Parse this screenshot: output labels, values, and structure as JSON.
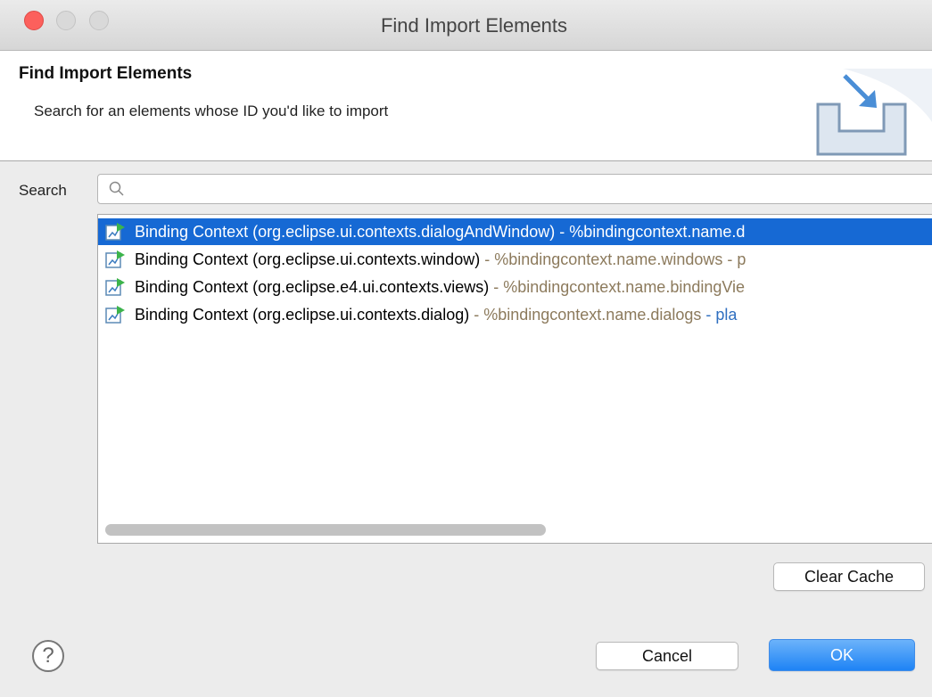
{
  "window": {
    "title": "Find Import Elements"
  },
  "header": {
    "title": "Find Import Elements",
    "description": "Search for an elements whose ID you'd like to import"
  },
  "search": {
    "label": "Search",
    "value": "",
    "placeholder": ""
  },
  "results": [
    {
      "main": "Binding Context (org.eclipse.ui.contexts.dialogAndWindow)",
      "sep": " - ",
      "name": "%bindingcontext.name.d",
      "extra": "",
      "selected": true
    },
    {
      "main": "Binding Context (org.eclipse.ui.contexts.window)",
      "sep": " - ",
      "name": "%bindingcontext.name.windows",
      "extra": " - p",
      "selected": false
    },
    {
      "main": "Binding Context (org.eclipse.e4.ui.contexts.views)",
      "sep": " - ",
      "name": "%bindingcontext.name.bindingVie",
      "extra": "",
      "selected": false
    },
    {
      "main": "Binding Context (org.eclipse.ui.contexts.dialog)",
      "sep": " - ",
      "name": "%bindingcontext.name.dialogs",
      "extra": " - pla",
      "selected": false
    }
  ],
  "buttons": {
    "clear_cache": "Clear Cache",
    "cancel": "Cancel",
    "ok": "OK",
    "help": "?"
  },
  "icons": {
    "result": "binding-context-icon",
    "header": "import-wizard-icon",
    "search": "search-icon"
  },
  "colors": {
    "selection": "#1669d4",
    "ok_button": "#1e83f5",
    "secondary_text": "#8c7a5c",
    "link_text": "#2f6fc0"
  }
}
